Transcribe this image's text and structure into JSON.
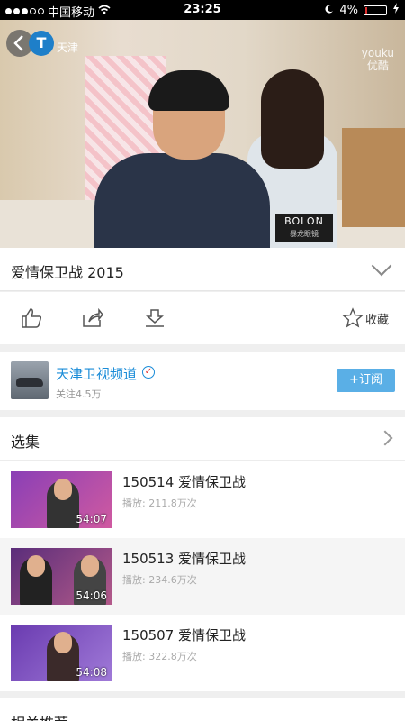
{
  "status_bar": {
    "carrier": "中国移动",
    "time": "23:25",
    "battery": "4%"
  },
  "video": {
    "channel_logo_text": "天津",
    "watermark_top": "youku",
    "watermark_bottom": "优酷",
    "sponsor_name": "BOLON",
    "sponsor_sub": "暴龙眼镜"
  },
  "title_row": {
    "title": "爱情保卫战 2015"
  },
  "actions": {
    "favorite_label": "收藏"
  },
  "channel": {
    "name": "天津卫视频道",
    "followers": "关注4.5万",
    "subscribe_label": "订阅",
    "subscribe_plus": "+"
  },
  "episodes": {
    "header": "选集",
    "items": [
      {
        "title": "150514 爱情保卫战",
        "plays": "播放: 211.8万次",
        "duration": "54:07"
      },
      {
        "title": "150513 爱情保卫战",
        "plays": "播放: 234.6万次",
        "duration": "54:06"
      },
      {
        "title": "150507 爱情保卫战",
        "plays": "播放: 322.8万次",
        "duration": "54:08"
      }
    ]
  },
  "related": {
    "header": "相关推荐"
  },
  "colors": {
    "accent": "#1a8cd8",
    "subscribe_bg": "#5aafe6",
    "divider": "#efefef"
  }
}
